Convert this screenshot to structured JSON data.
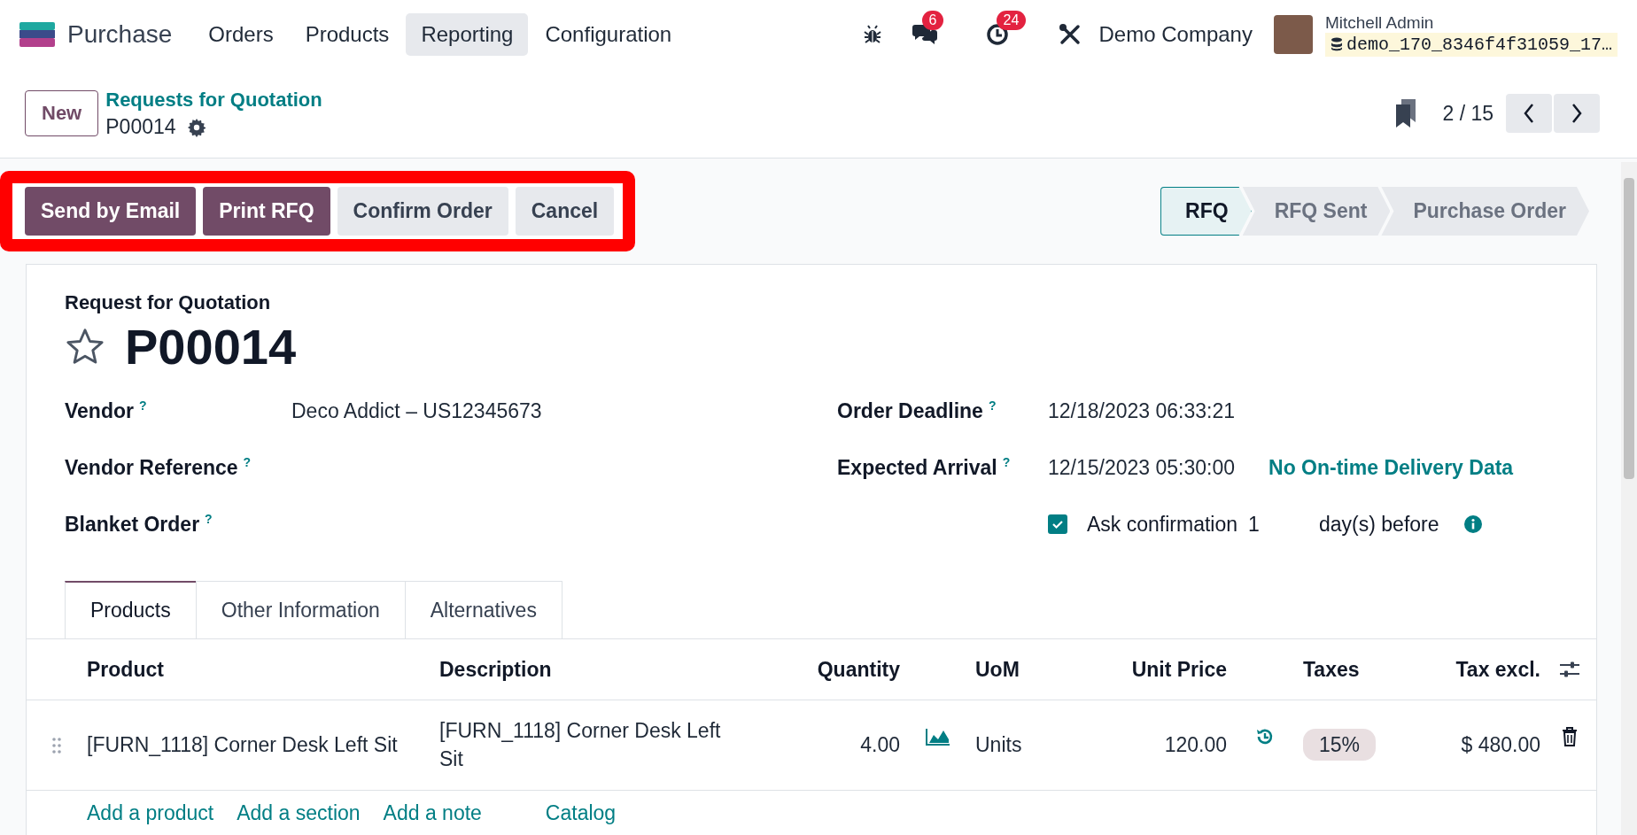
{
  "navbar": {
    "app_name": "Purchase",
    "menus": [
      {
        "label": "Orders",
        "selected": false
      },
      {
        "label": "Products",
        "selected": false
      },
      {
        "label": "Reporting",
        "selected": true
      },
      {
        "label": "Configuration",
        "selected": false
      }
    ],
    "messages_count": "6",
    "activities_count": "24",
    "company": "Demo Company",
    "user": "Mitchell Admin",
    "database": "demo_170_8346f4f31059_17…"
  },
  "control_panel": {
    "new_button": "New",
    "breadcrumb_parent": "Requests for Quotation",
    "breadcrumb_current": "P00014",
    "pager": "2 / 15"
  },
  "action_bar": {
    "highlighted": true,
    "buttons": [
      {
        "label": "Send by Email",
        "kind": "primary"
      },
      {
        "label": "Print RFQ",
        "kind": "primary"
      },
      {
        "label": "Confirm Order",
        "kind": "secondary"
      },
      {
        "label": "Cancel",
        "kind": "secondary"
      }
    ]
  },
  "status_bar": [
    {
      "label": "RFQ",
      "selected": true
    },
    {
      "label": "RFQ Sent",
      "selected": false
    },
    {
      "label": "Purchase Order",
      "selected": false
    }
  ],
  "form": {
    "subtitle": "Request for Quotation",
    "title": "P00014",
    "starred": false,
    "left_fields": [
      {
        "label": "Vendor",
        "help": "?",
        "value": "Deco Addict – US12345673"
      },
      {
        "label": "Vendor Reference",
        "help": "?"
      },
      {
        "label": "Blanket Order",
        "help": "?"
      }
    ],
    "right_fields": [
      {
        "label": "Order Deadline",
        "help": "?",
        "value": "12/18/2023 06:33:21"
      },
      {
        "label": "Expected Arrival",
        "help": "?",
        "value": "12/15/2023 05:30:00",
        "link": "No On-time Delivery Data"
      }
    ],
    "ask_confirmation": {
      "checked": true,
      "label": "Ask confirmation",
      "value": "1",
      "suffix": "day(s) before"
    }
  },
  "tabs": [
    {
      "label": "Products",
      "selected": true
    },
    {
      "label": "Other Information",
      "selected": false
    },
    {
      "label": "Alternatives",
      "selected": false
    }
  ],
  "table": {
    "columns": [
      "Product",
      "Description",
      "Quantity",
      "UoM",
      "Unit Price",
      "Taxes",
      "Tax excl."
    ],
    "rows": [
      {
        "product": "[FURN_1118] Corner Desk Left Sit",
        "description": "[FURN_1118] Corner Desk Left Sit",
        "quantity": "4.00",
        "uom": "Units",
        "unit_price": "120.00",
        "taxes": "15%",
        "tax_excl": "$ 480.00"
      }
    ],
    "add_links": [
      "Add a product",
      "Add a section",
      "Add a note",
      "Catalog"
    ]
  }
}
